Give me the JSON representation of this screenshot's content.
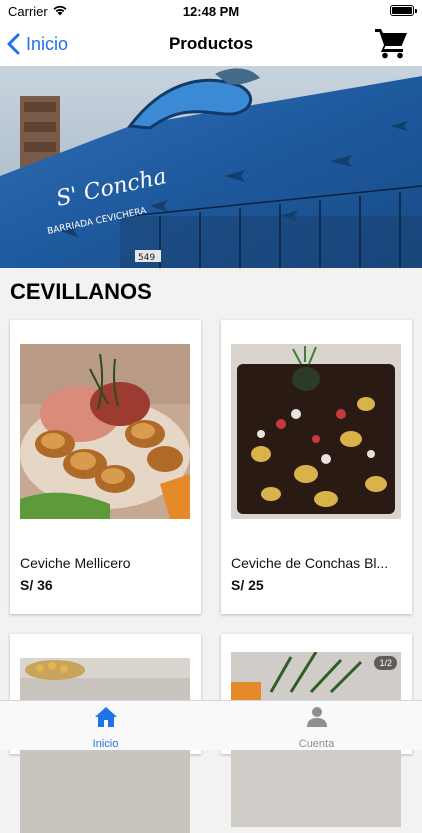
{
  "status_bar": {
    "carrier": "Carrier",
    "time": "12:48 PM"
  },
  "nav": {
    "back_label": "Inicio",
    "title": "Productos",
    "cart_icon": "shopping-cart-icon"
  },
  "hero": {
    "sign_line1": "S' Concha",
    "sign_line2": "BARRIADA CEVICHERA",
    "door_number": "549"
  },
  "section": {
    "title": "CEVILLANOS"
  },
  "products": [
    {
      "name": "Ceviche Mellicero",
      "price": "S/ 36"
    },
    {
      "name": "Ceviche de Conchas Bl...",
      "price": "S/ 25"
    },
    {
      "name": "",
      "price": ""
    },
    {
      "name": "",
      "price": ""
    }
  ],
  "image_badge": "1/2",
  "tabs": [
    {
      "label": "Inicio",
      "icon": "home-icon",
      "active": true
    },
    {
      "label": "Cuenta",
      "icon": "user-icon",
      "active": false
    }
  ],
  "colors": {
    "accent": "#1e73e8",
    "inactive": "#8e8e93",
    "background": "#f2f2f2"
  }
}
